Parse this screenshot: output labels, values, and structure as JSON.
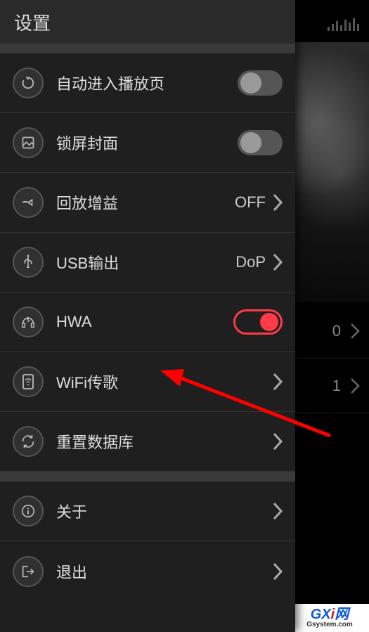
{
  "header": {
    "title": "设置"
  },
  "rows": {
    "autoplay": {
      "label": "自动进入播放页",
      "toggle": false
    },
    "lockcover": {
      "label": "锁屏封面",
      "toggle": false
    },
    "replaygain": {
      "label": "回放增益",
      "value": "OFF"
    },
    "usbout": {
      "label": "USB输出",
      "value": "DoP"
    },
    "hwa": {
      "label": "HWA",
      "toggle": true
    },
    "wifi": {
      "label": "WiFi传歌"
    },
    "rebuild": {
      "label": "重置数据库"
    },
    "about": {
      "label": "关于"
    },
    "exit": {
      "label": "退出"
    }
  },
  "bg": {
    "count0": "0",
    "count1": "1"
  },
  "watermark": {
    "line1a": "GX",
    "line1b": "i",
    "line1c": "网",
    "line2": "Gsystem.com"
  }
}
